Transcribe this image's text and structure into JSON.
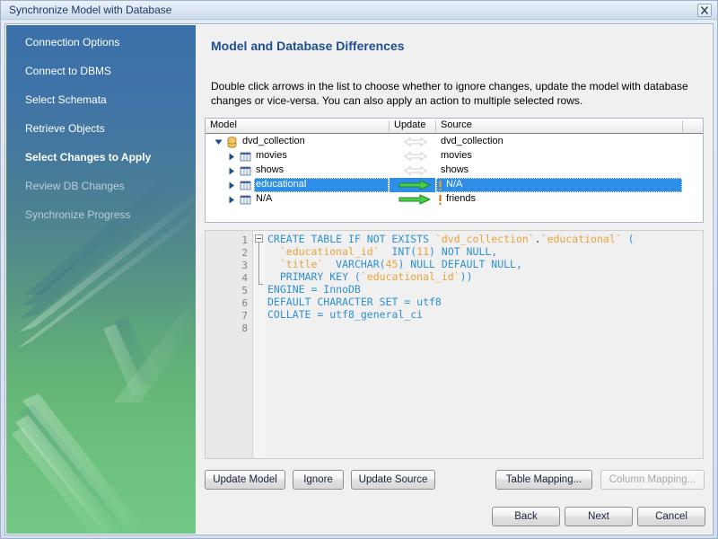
{
  "window": {
    "title": "Synchronize Model with Database",
    "close_icon": "close-icon"
  },
  "sidebar": {
    "items": [
      {
        "label": "Connection Options",
        "state": "done"
      },
      {
        "label": "Connect to DBMS",
        "state": "done"
      },
      {
        "label": "Select Schemata",
        "state": "done"
      },
      {
        "label": "Retrieve Objects",
        "state": "done"
      },
      {
        "label": "Select Changes to Apply",
        "state": "current"
      },
      {
        "label": "Review DB Changes",
        "state": "disabled"
      },
      {
        "label": "Synchronize Progress",
        "state": "disabled"
      }
    ]
  },
  "page": {
    "title": "Model and Database Differences",
    "description": "Double click arrows in the list to choose whether to ignore changes, update the model with database changes or vice-versa. You can also apply an action to multiple selected rows."
  },
  "tree": {
    "columns": [
      "Model",
      "Update",
      "Source"
    ],
    "rows": [
      {
        "model": "dvd_collection",
        "icon": "database-icon",
        "update": "no-change-arrow",
        "source": "dvd_collection",
        "source_warning": false,
        "depth": 0,
        "expanded": true,
        "selected": false
      },
      {
        "model": "movies",
        "icon": "table-icon",
        "update": "no-change-arrow",
        "source": "movies",
        "source_warning": false,
        "depth": 1,
        "expanded": false,
        "selected": false
      },
      {
        "model": "shows",
        "icon": "table-icon",
        "update": "no-change-arrow",
        "source": "shows",
        "source_warning": false,
        "depth": 1,
        "expanded": false,
        "selected": false
      },
      {
        "model": "educational",
        "icon": "table-icon",
        "update": "update-source-arrow",
        "source": "N/A",
        "source_warning": true,
        "depth": 1,
        "expanded": false,
        "selected": true
      },
      {
        "model": "N/A",
        "icon": "table-icon",
        "update": "update-source-arrow",
        "source": "friends",
        "source_warning": true,
        "depth": 1,
        "expanded": false,
        "selected": false
      }
    ]
  },
  "sql": {
    "line_numbers": [
      "1",
      "2",
      "3",
      "4",
      "5",
      "6",
      "7",
      "8"
    ],
    "lines": [
      [
        {
          "t": "CREATE TABLE IF NOT EXISTS ",
          "c": "kw"
        },
        {
          "t": "`dvd_collection`",
          "c": "id"
        },
        {
          "t": ".",
          "c": "pl"
        },
        {
          "t": "`educational`",
          "c": "id"
        },
        {
          "t": " (",
          "c": "kw"
        }
      ],
      [
        {
          "t": "  ",
          "c": "pl"
        },
        {
          "t": "`educational_id`",
          "c": "id"
        },
        {
          "t": "  INT(",
          "c": "kw"
        },
        {
          "t": "11",
          "c": "num"
        },
        {
          "t": ") NOT NULL,",
          "c": "kw"
        }
      ],
      [
        {
          "t": "  ",
          "c": "pl"
        },
        {
          "t": "`title`",
          "c": "id"
        },
        {
          "t": "  VARCHAR(",
          "c": "kw"
        },
        {
          "t": "45",
          "c": "num"
        },
        {
          "t": ") NULL DEFAULT NULL,",
          "c": "kw"
        }
      ],
      [
        {
          "t": "  PRIMARY KEY (",
          "c": "kw"
        },
        {
          "t": "`educational_id`",
          "c": "id"
        },
        {
          "t": "))",
          "c": "kw"
        }
      ],
      [
        {
          "t": "ENGINE = InnoDB",
          "c": "kw"
        }
      ],
      [
        {
          "t": "DEFAULT CHARACTER SET = utf8",
          "c": "kw"
        }
      ],
      [
        {
          "t": "COLLATE = utf8_general_ci",
          "c": "kw"
        }
      ],
      []
    ]
  },
  "actions": {
    "update_model": "Update Model",
    "ignore": "Ignore",
    "update_source": "Update Source",
    "table_mapping": "Table Mapping...",
    "column_mapping": "Column Mapping...",
    "back": "Back",
    "next": "Next",
    "cancel": "Cancel"
  },
  "colors": {
    "accent_blue": "#1d4f91",
    "selection": "#2f8fe8",
    "arrow_green": "#35b235",
    "arrow_gray": "#d9dde2",
    "warning_orange": "#e8820c",
    "sql_keyword": "#2f8fd0",
    "sql_identifier": "#e8a33d"
  }
}
